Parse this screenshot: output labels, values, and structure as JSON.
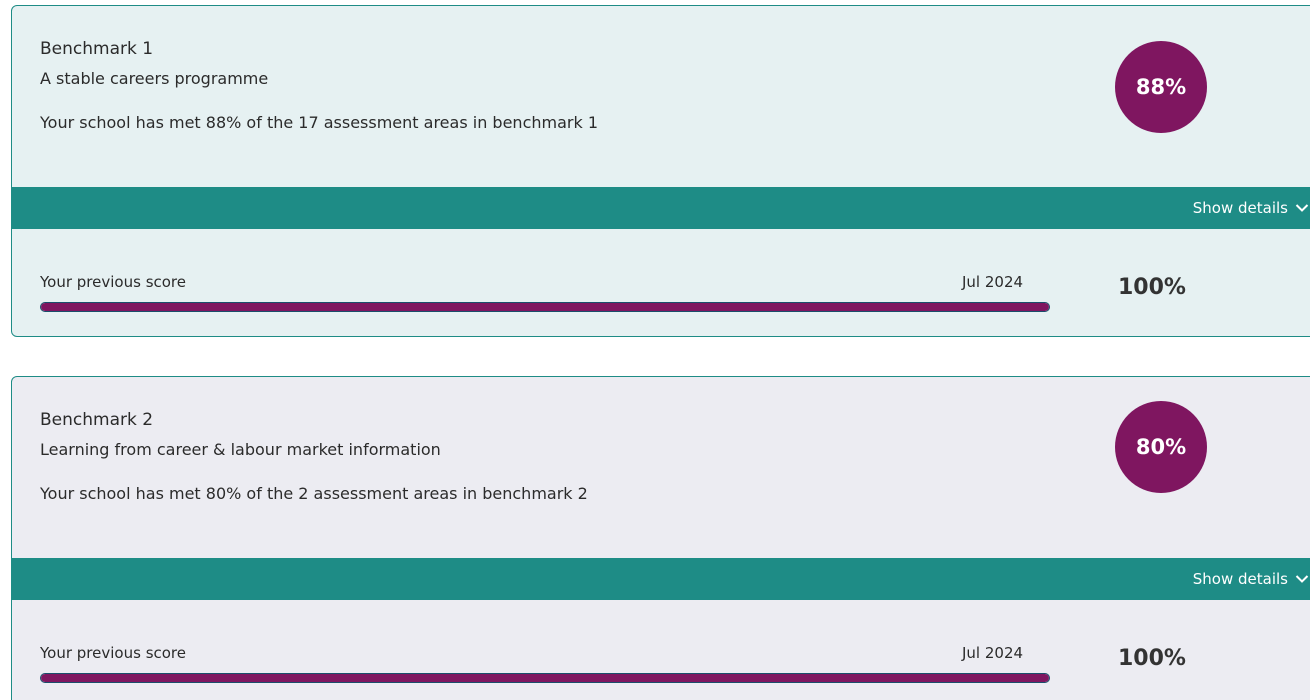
{
  "benchmarks": [
    {
      "title": "Benchmark 1",
      "subtitle": "A stable careers programme",
      "description": "Your school has met 88% of the 17 assessment areas in benchmark 1",
      "score": "88%",
      "show_details_label": "Show details",
      "previous_label": "Your previous score",
      "previous_date": "Jul 2024",
      "previous_score": "100%",
      "previous_progress": 1.0
    },
    {
      "title": "Benchmark 2",
      "subtitle": "Learning from career & labour market information",
      "description": "Your school has met 80% of the 2 assessment areas in benchmark 2",
      "score": "80%",
      "show_details_label": "Show details",
      "previous_label": "Your previous score",
      "previous_date": "Jul 2024",
      "previous_score": "100%",
      "previous_progress": 1.0
    }
  ],
  "colors": {
    "accent_teal": "#1e8c86",
    "score_purple": "#7f1660",
    "card1_bg": "#e6f1f2",
    "card2_bg": "#ececf2"
  },
  "icons": {
    "show_details": "chevron-down-icon"
  }
}
